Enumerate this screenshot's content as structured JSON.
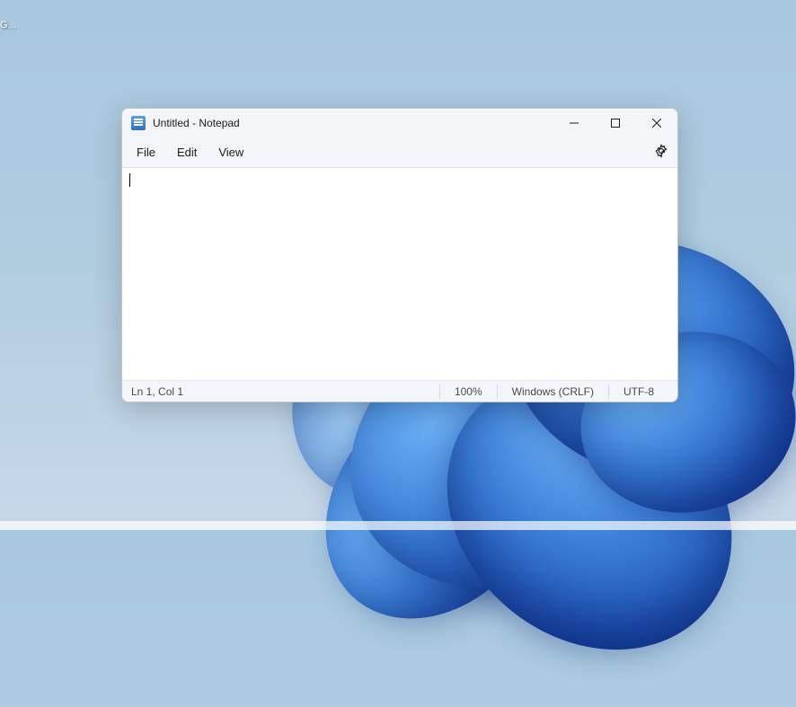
{
  "desktop": {
    "icon_label": "G..."
  },
  "window": {
    "title": "Untitled - Notepad",
    "menubar": {
      "file": "File",
      "edit": "Edit",
      "view": "View"
    },
    "editor": {
      "content": ""
    },
    "statusbar": {
      "position": "Ln 1, Col 1",
      "zoom": "100%",
      "line_ending": "Windows (CRLF)",
      "encoding": "UTF-8"
    }
  }
}
